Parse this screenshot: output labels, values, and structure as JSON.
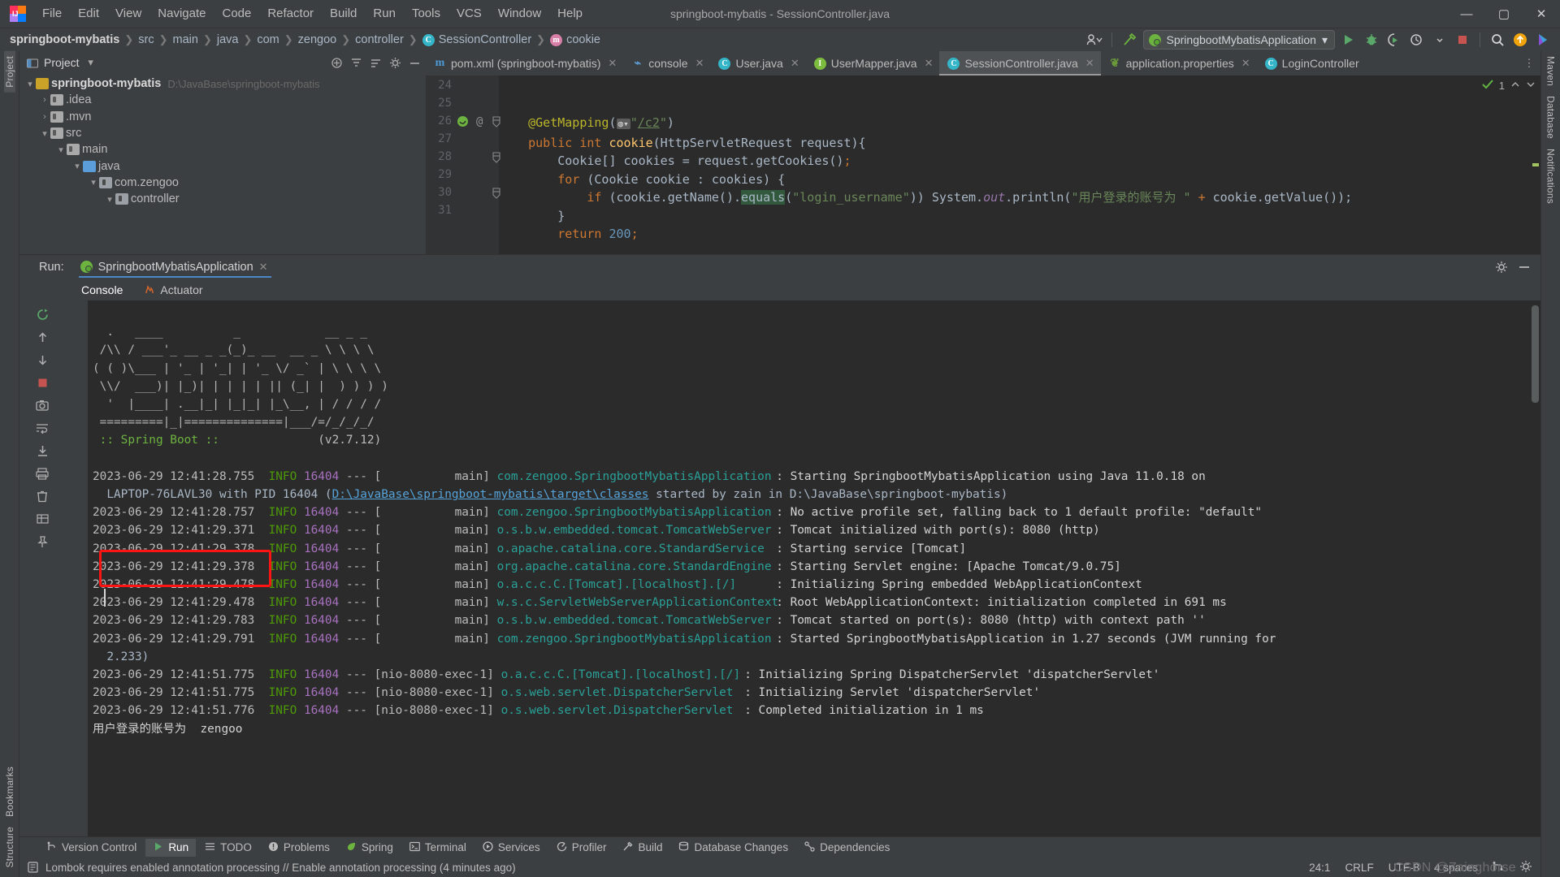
{
  "window": {
    "title": "springboot-mybatis - SessionController.java",
    "controls": {
      "minimize": "—",
      "maximize": "▢",
      "close": "✕"
    }
  },
  "menu": [
    {
      "label": "File"
    },
    {
      "label": "Edit"
    },
    {
      "label": "View"
    },
    {
      "label": "Navigate"
    },
    {
      "label": "Code"
    },
    {
      "label": "Refactor"
    },
    {
      "label": "Build"
    },
    {
      "label": "Run"
    },
    {
      "label": "Tools"
    },
    {
      "label": "VCS"
    },
    {
      "label": "Window"
    },
    {
      "label": "Help"
    }
  ],
  "breadcrumb": [
    {
      "label": "springboot-mybatis",
      "bold": true
    },
    {
      "label": "src"
    },
    {
      "label": "main"
    },
    {
      "label": "java"
    },
    {
      "label": "com"
    },
    {
      "label": "zengoo"
    },
    {
      "label": "controller"
    },
    {
      "label": "SessionController",
      "badge": "C"
    },
    {
      "label": "cookie",
      "badge": "m"
    }
  ],
  "toolbar": {
    "run_config": "SpringbootMybatisApplication",
    "run_config_caret": "▾",
    "icons": [
      "user-dropdown-icon",
      "hammer-build-icon",
      "run-icon",
      "debug-icon",
      "run-coverage-icon",
      "profiler-icon",
      "stop-icon",
      "search-icon",
      "update-project-icon",
      "ide-feature-icon"
    ]
  },
  "project_pane": {
    "title": "Project",
    "caret": "▾",
    "tools": [
      "expand-all-icon",
      "collapse-all-icon",
      "sort-icon",
      "settings-icon",
      "hide-icon"
    ],
    "tree": [
      {
        "depth": 0,
        "arrow": "▾",
        "icon": "module",
        "label": "springboot-mybatis",
        "path": "D:\\JavaBase\\springboot-mybatis",
        "root": true
      },
      {
        "depth": 1,
        "arrow": "›",
        "icon": "folder",
        "label": ".idea"
      },
      {
        "depth": 1,
        "arrow": "›",
        "icon": "folder",
        "label": ".mvn"
      },
      {
        "depth": 1,
        "arrow": "▾",
        "icon": "folder",
        "label": "src"
      },
      {
        "depth": 2,
        "arrow": "▾",
        "icon": "folder",
        "label": "main"
      },
      {
        "depth": 3,
        "arrow": "▾",
        "icon": "src",
        "label": "java"
      },
      {
        "depth": 4,
        "arrow": "▾",
        "icon": "pkg",
        "label": "com.zengoo"
      },
      {
        "depth": 5,
        "arrow": "▾",
        "icon": "pkg",
        "label": "controller"
      }
    ]
  },
  "editor_tabs": [
    {
      "label": "pom.xml (springboot-mybatis)",
      "icon": "maven-icon",
      "kind": "m",
      "active": false,
      "close": "✕"
    },
    {
      "label": "console",
      "icon": "console-file-icon",
      "kind": "console",
      "active": false,
      "close": "✕"
    },
    {
      "label": "User.java",
      "icon": "class-icon",
      "kind": "c",
      "active": false,
      "close": "✕"
    },
    {
      "label": "UserMapper.java",
      "icon": "interface-icon",
      "kind": "i",
      "active": false,
      "close": "✕"
    },
    {
      "label": "SessionController.java",
      "icon": "class-icon",
      "kind": "c",
      "active": true,
      "close": "✕"
    },
    {
      "label": "application.properties",
      "icon": "spring-properties-icon",
      "kind": "leaf",
      "active": false,
      "close": "✕"
    },
    {
      "label": "LoginController",
      "icon": "class-icon",
      "kind": "c",
      "active": false,
      "close": ""
    }
  ],
  "editor": {
    "inspection_count": "1",
    "lines": [
      {
        "num": "24",
        "text": ""
      },
      {
        "num": "25",
        "text": "    @GetMapping(\"/c2\")"
      },
      {
        "num": "26",
        "text": "    public int cookie(HttpServletRequest request){"
      },
      {
        "num": "27",
        "text": "        Cookie[] cookies = request.getCookies();"
      },
      {
        "num": "28",
        "text": "        for (Cookie cookie : cookies) {"
      },
      {
        "num": "29",
        "text": "            if (cookie.getName().equals(\"login_username\")) System.out.println(\"用户登录的账号为 \" + cookie.getValue());"
      },
      {
        "num": "30",
        "text": "        }"
      },
      {
        "num": "31",
        "text": "        return 200;"
      }
    ]
  },
  "run_window": {
    "label": "Run:",
    "tab": "SpringbootMybatisApplication",
    "tab_close": "✕",
    "subtabs": [
      {
        "label": "Console",
        "active": true,
        "icon": "console-icon"
      },
      {
        "label": "Actuator",
        "active": false,
        "icon": "actuator-icon"
      }
    ],
    "header_icons": [
      "settings-gear-icon",
      "hide-window-icon"
    ],
    "side_icons": [
      "rerun-icon",
      "scroll-up-icon",
      "scroll-down-icon",
      "stop-icon",
      "screenshot-icon",
      "soft-wrap-icon",
      "scroll-to-end-icon",
      "print-icon",
      "clear-all-icon",
      "grid-icon",
      "pin-icon"
    ]
  },
  "console": {
    "banner": [
      "  .   ____          _            __ _ _",
      " /\\\\ / ___'_ __ _ _(_)_ __  __ _ \\ \\ \\ \\",
      "( ( )\\___ | '_ | '_| | '_ \\/ _` | \\ \\ \\ \\",
      " \\\\/  ___)| |_)| | | | | || (_| |  ) ) ) )",
      "  '  |____| .__|_| |_|_| |_\\__, | / / / /",
      " =========|_|==============|___/=/_/_/_/"
    ],
    "spring_boot_label": " :: Spring Boot :: ",
    "spring_boot_version": "(v2.7.12)",
    "lines": [
      {
        "ts": "2023-06-29 12:41:28.755",
        "level": "INFO",
        "pid": "16404",
        "thread": "main",
        "logger": "com.zengoo.SpringbootMybatisApplication",
        "msg": ": Starting SpringbootMybatisApplication using Java 11.0.18 on"
      },
      {
        "continuation": true,
        "pre": "  LAPTOP-76LAVL30 with PID 16404 (",
        "link": "D:\\JavaBase\\springboot-mybatis\\target\\classes",
        "post": " started by zain in D:\\JavaBase\\springboot-mybatis)"
      },
      {
        "ts": "2023-06-29 12:41:28.757",
        "level": "INFO",
        "pid": "16404",
        "thread": "main",
        "logger": "com.zengoo.SpringbootMybatisApplication",
        "msg": ": No active profile set, falling back to 1 default profile: \"default\""
      },
      {
        "ts": "2023-06-29 12:41:29.371",
        "level": "INFO",
        "pid": "16404",
        "thread": "main",
        "logger": "o.s.b.w.embedded.tomcat.TomcatWebServer",
        "msg": ": Tomcat initialized with port(s): 8080 (http)"
      },
      {
        "ts": "2023-06-29 12:41:29.378",
        "level": "INFO",
        "pid": "16404",
        "thread": "main",
        "logger": "o.apache.catalina.core.StandardService",
        "msg": ": Starting service [Tomcat]"
      },
      {
        "ts": "2023-06-29 12:41:29.378",
        "level": "INFO",
        "pid": "16404",
        "thread": "main",
        "logger": "org.apache.catalina.core.StandardEngine",
        "msg": ": Starting Servlet engine: [Apache Tomcat/9.0.75]"
      },
      {
        "ts": "2023-06-29 12:41:29.478",
        "level": "INFO",
        "pid": "16404",
        "thread": "main",
        "logger": "o.a.c.c.C.[Tomcat].[localhost].[/]",
        "msg": ": Initializing Spring embedded WebApplicationContext"
      },
      {
        "ts": "2023-06-29 12:41:29.478",
        "level": "INFO",
        "pid": "16404",
        "thread": "main",
        "logger": "w.s.c.ServletWebServerApplicationContext",
        "msg": ": Root WebApplicationContext: initialization completed in 691 ms"
      },
      {
        "ts": "2023-06-29 12:41:29.783",
        "level": "INFO",
        "pid": "16404",
        "thread": "main",
        "logger": "o.s.b.w.embedded.tomcat.TomcatWebServer",
        "msg": ": Tomcat started on port(s): 8080 (http) with context path ''"
      },
      {
        "ts": "2023-06-29 12:41:29.791",
        "level": "INFO",
        "pid": "16404",
        "thread": "main",
        "logger": "com.zengoo.SpringbootMybatisApplication",
        "msg": ": Started SpringbootMybatisApplication in 1.27 seconds (JVM running for"
      },
      {
        "continuation": true,
        "pre": "  2.233)",
        "link": "",
        "post": ""
      },
      {
        "ts": "2023-06-29 12:41:51.775",
        "level": "INFO",
        "pid": "16404",
        "thread": "nio-8080-exec-1",
        "logger": "o.a.c.c.C.[Tomcat].[localhost].[/]",
        "msg": ": Initializing Spring DispatcherServlet 'dispatcherServlet'"
      },
      {
        "ts": "2023-06-29 12:41:51.775",
        "level": "INFO",
        "pid": "16404",
        "thread": "nio-8080-exec-1",
        "logger": "o.s.web.servlet.DispatcherServlet",
        "msg": ": Initializing Servlet 'dispatcherServlet'"
      },
      {
        "ts": "2023-06-29 12:41:51.776",
        "level": "INFO",
        "pid": "16404",
        "thread": "nio-8080-exec-1",
        "logger": "o.s.web.servlet.DispatcherServlet",
        "msg": ": Completed initialization in 1 ms"
      }
    ],
    "highlighted_output": "用户登录的账号为  zengoo",
    "highlight_color": "#fc1414"
  },
  "toolwindow_bar": [
    {
      "label": "Version Control",
      "icon": "branch-icon",
      "active": false
    },
    {
      "label": "Run",
      "icon": "run-icon",
      "active": true
    },
    {
      "label": "TODO",
      "icon": "todo-icon",
      "active": false
    },
    {
      "label": "Problems",
      "icon": "problems-icon",
      "active": false
    },
    {
      "label": "Spring",
      "icon": "spring-leaf-icon",
      "active": false
    },
    {
      "label": "Terminal",
      "icon": "terminal-icon",
      "active": false
    },
    {
      "label": "Services",
      "icon": "services-icon",
      "active": false
    },
    {
      "label": "Profiler",
      "icon": "profiler-icon",
      "active": false
    },
    {
      "label": "Build",
      "icon": "build-hammer-icon",
      "active": false
    },
    {
      "label": "Database Changes",
      "icon": "db-changes-icon",
      "active": false
    },
    {
      "label": "Dependencies",
      "icon": "dependencies-icon",
      "active": false
    }
  ],
  "statusbar": {
    "message": "Lombok requires enabled annotation processing // Enable annotation processing (4 minutes ago)",
    "caret_position": "24:1",
    "line_separator": "CRLF",
    "encoding": "UTF-8",
    "indent": "4 spaces",
    "icons": [
      "git-branch-icon",
      "settings-gear-icon"
    ]
  },
  "watermark": "CSDN @Zainghorse",
  "left_rail": [
    {
      "label": "Project",
      "active": true
    },
    {
      "label": "Bookmarks",
      "active": false
    },
    {
      "label": "Structure",
      "active": false
    }
  ],
  "right_rail": [
    {
      "label": "Maven",
      "active": false
    },
    {
      "label": "Database",
      "active": false
    },
    {
      "label": "Notifications",
      "active": false
    }
  ],
  "colors": {
    "accent_blue": "#4a88c7",
    "spring_green": "#6db33f",
    "info_green": "#4e9a06",
    "pid_purple": "#a771bf",
    "logger_cyan": "#2aa198",
    "highlight_red": "#fc1414",
    "bg_panel": "#3c3f41",
    "bg_editor": "#2b2b2b"
  }
}
